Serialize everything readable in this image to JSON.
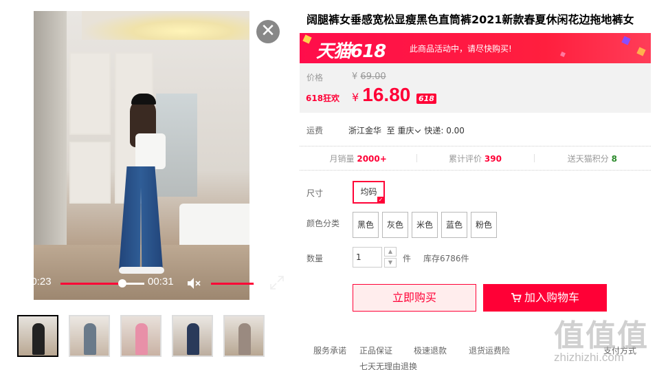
{
  "product": {
    "title": "阔腿裤女垂感宽松显瘦黑色直筒裤2021新款春夏休闲花边拖地裤女"
  },
  "video": {
    "current_time": "00:23",
    "duration": "00:31",
    "progress": 0.74,
    "volume": 0.97
  },
  "thumbnails": [
    {
      "index": 1,
      "active": true
    },
    {
      "index": 2,
      "active": false
    },
    {
      "index": 3,
      "active": false
    },
    {
      "index": 4,
      "active": false
    },
    {
      "index": 5,
      "active": false
    }
  ],
  "promo": {
    "logo": "天猫618",
    "text": "此商品活动中，请尽快购买!",
    "color": "#ff0036"
  },
  "price": {
    "label": "价格",
    "currency": "¥",
    "original": "69.00",
    "activity_label": "618狂欢",
    "current": "16.80",
    "tag": "618"
  },
  "shipping": {
    "label": "运费",
    "from": "浙江金华",
    "to_prefix": "至",
    "to": "重庆",
    "express": "快递: 0.00"
  },
  "stats": {
    "sales_label": "月销量",
    "sales_value": "2000+",
    "reviews_label": "累计评价",
    "reviews_value": "390",
    "points_label": "送天猫积分",
    "points_value": "8"
  },
  "size": {
    "label": "尺寸",
    "options": [
      "均码"
    ],
    "selected": "均码"
  },
  "color": {
    "label": "颜色分类",
    "options": [
      "黑色",
      "灰色",
      "米色",
      "蓝色",
      "粉色"
    ]
  },
  "quantity": {
    "label": "数量",
    "value": "1",
    "unit": "件",
    "stock": "库存6786件"
  },
  "actions": {
    "buy_now": "立即购买",
    "add_to_cart": "加入购物车"
  },
  "services": {
    "label": "服务承诺",
    "items": [
      "正品保证",
      "极速退款",
      "退货运费险",
      "七天无理由退换"
    ],
    "payment": "支付方式"
  },
  "watermark": {
    "logo": "值值值",
    "url": "zhizhizhi.com"
  }
}
